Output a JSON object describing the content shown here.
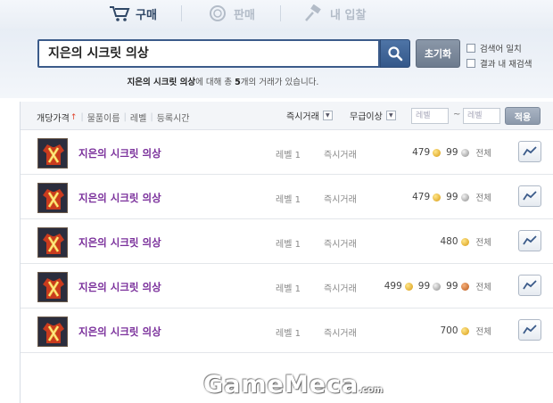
{
  "tabs": [
    {
      "label": "구매",
      "icon": "cart-icon",
      "active": true
    },
    {
      "label": "판매",
      "icon": "coin-icon",
      "active": false
    },
    {
      "label": "내 입찰",
      "icon": "gavel-icon",
      "active": false
    }
  ],
  "search": {
    "query": "지은의 시크릿 의상",
    "reset_label": "초기화",
    "options": [
      "검색어 일치",
      "결과 내 재검색"
    ],
    "result_prefix": "지은의 시크릿 의상",
    "result_middle": "에 대해 총 ",
    "result_count": "5",
    "result_suffix": "개의 거래가 있습니다."
  },
  "filters": {
    "sort_links": [
      "개당가격",
      "물품이름",
      "레벨",
      "등록시간"
    ],
    "sort_active_arrow": "↑",
    "trade_type": "즉시거래",
    "grade": "무급이상",
    "level_min_placeholder": "레벨",
    "level_max_placeholder": "레벨",
    "tilde": "~",
    "apply_label": "적용"
  },
  "listings": [
    {
      "name": "지은의 시크릿 의상",
      "level": "레벨 1",
      "type": "즉시거래",
      "prices": [
        {
          "amount": "479",
          "coin": "gold"
        },
        {
          "amount": "99",
          "coin": "silver"
        }
      ],
      "scope": "전체"
    },
    {
      "name": "지은의 시크릿 의상",
      "level": "레벨 1",
      "type": "즉시거래",
      "prices": [
        {
          "amount": "479",
          "coin": "gold"
        },
        {
          "amount": "99",
          "coin": "silver"
        }
      ],
      "scope": "전체"
    },
    {
      "name": "지은의 시크릿 의상",
      "level": "레벨 1",
      "type": "즉시거래",
      "prices": [
        {
          "amount": "480",
          "coin": "gold"
        }
      ],
      "scope": "전체"
    },
    {
      "name": "지은의 시크릿 의상",
      "level": "레벨 1",
      "type": "즉시거래",
      "prices": [
        {
          "amount": "499",
          "coin": "gold"
        },
        {
          "amount": "99",
          "coin": "silver"
        },
        {
          "amount": "99",
          "coin": "copper"
        }
      ],
      "scope": "전체"
    },
    {
      "name": "지은의 시크릿 의상",
      "level": "레벨 1",
      "type": "즉시거래",
      "prices": [
        {
          "amount": "700",
          "coin": "gold"
        }
      ],
      "scope": "전체"
    }
  ],
  "watermark": {
    "text": "GameMeca",
    "suffix": ".com"
  },
  "colors": {
    "accent": "#3b5b8a",
    "item_name": "#7a2f9b",
    "gold": "#d79a12"
  }
}
